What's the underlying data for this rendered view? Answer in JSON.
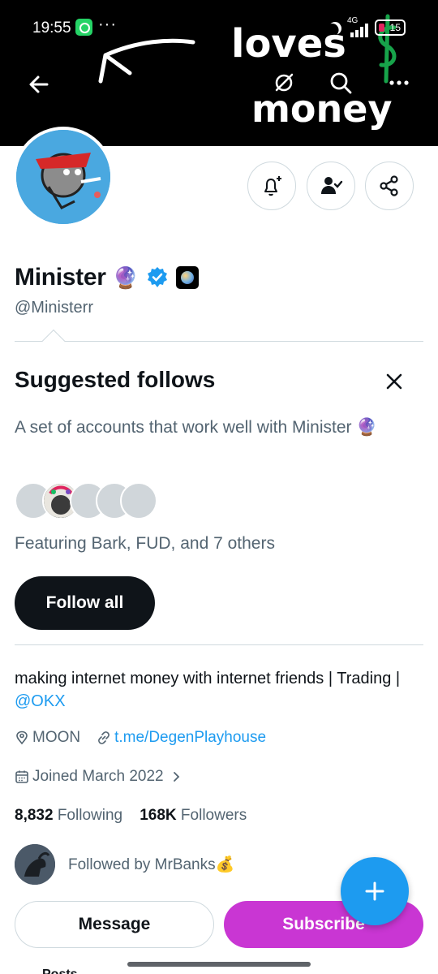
{
  "status_bar": {
    "time": "19:55",
    "more": "···",
    "network": "4G",
    "battery": "15"
  },
  "header": {
    "back_icon": "arrow-left-icon",
    "grok_icon": "grok-icon",
    "search_icon": "search-icon",
    "more_icon": "more-horizontal-icon",
    "banner_doodle_text": [
      "loves",
      "money"
    ]
  },
  "profile": {
    "display_name": "Minister",
    "handle": "@Ministerr",
    "name_emoji": "🔮",
    "verified_color": "#1d9bf0"
  },
  "actions": {
    "notify_icon": "bell-plus-icon",
    "following_icon": "person-check-icon",
    "share_icon": "share-icon"
  },
  "suggested": {
    "title": "Suggested follows",
    "description": "A set of accounts that work well with Minister 🔮",
    "featuring": "Featuring Bark, FUD, and 7 others",
    "follow_all": "Follow all"
  },
  "bio": {
    "text": "making internet money with internet friends | Trading | ",
    "mention": "@OKX",
    "location": "MOON",
    "website": "t.me/DegenPlayhouse",
    "joined": "Joined March 2022"
  },
  "stats": {
    "following_count": "8,832",
    "following_label": "Following",
    "followers_count": "168K",
    "followers_label": "Followers"
  },
  "followed_by": {
    "text": "Followed by MrBanks💰"
  },
  "buttons": {
    "message": "Message",
    "subscribe": "Subscribe",
    "subscribe_color": "#c936d3"
  },
  "tabbar": {
    "first_tab": "Posts"
  }
}
